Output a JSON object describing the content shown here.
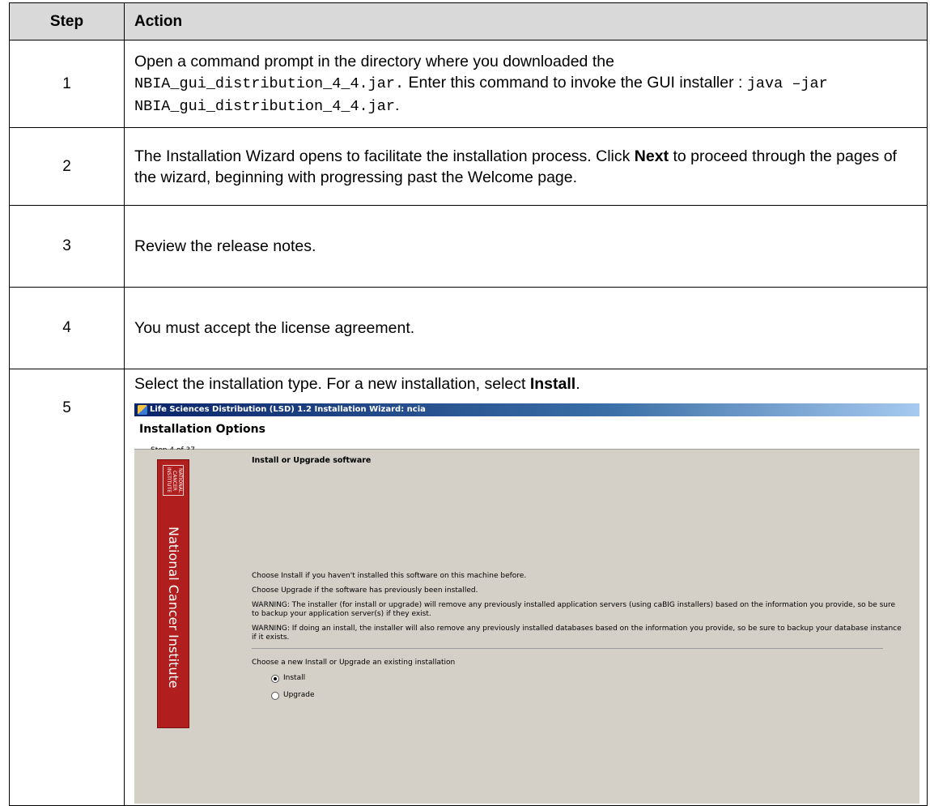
{
  "table": {
    "header": {
      "step": "Step",
      "action": "Action"
    },
    "rows": [
      {
        "step": "1",
        "action": {
          "t1": "Open a command prompt in the directory where you downloaded the",
          "code1": "NBIA_gui_distribution_4_4.jar.",
          "t2": " Enter this command to invoke the GUI installer : ",
          "code2": "java –jar NBIA_gui_distribution_4_4.jar",
          "t3": "."
        }
      },
      {
        "step": "2",
        "action": {
          "t1": "The Installation Wizard opens to facilitate the installation process. Click ",
          "bold": "Next",
          "t2": " to proceed through the pages of the wizard, beginning with progressing past the Welcome page."
        }
      },
      {
        "step": "3",
        "action": {
          "text": "Review the release notes."
        }
      },
      {
        "step": "4",
        "action": {
          "text": "You must accept the license agreement."
        }
      },
      {
        "step": "5",
        "action": {
          "t1": "Select the installation type. For a new installation, select ",
          "bold": "Install",
          "t2": "."
        }
      }
    ]
  },
  "wizard": {
    "window_title": "Life Sciences Distribution (LSD) 1.2 Installation Wizard: ncia",
    "header_title": "Installation Options",
    "step_text": "Step 4 of 37",
    "banner_text": "National Cancer Institute",
    "logo_text": "NATIONAL CANCER INSTITUTE",
    "section_title": "Install or Upgrade software",
    "lines": [
      "Choose Install if you haven't installed this software on this machine before.",
      "Choose Upgrade if the software has previously been installed.",
      "WARNING: The installer (for install or upgrade) will remove any previously installed application servers (using caBIG installers) based on the information you provide, so be sure to backup your application server(s) if they exist.",
      "WARNING: If doing an install, the installer will also remove any previously installed databases based on the information you provide, so be sure to backup your database instance if it exists."
    ],
    "choose_label": "Choose a new Install or Upgrade an existing installation",
    "options": [
      {
        "label": "Install",
        "selected": true
      },
      {
        "label": "Upgrade",
        "selected": false
      }
    ],
    "colors": {
      "banner": "#b01e1e",
      "dialog_bg": "#d4d0c8",
      "titlebar": "#0a246a"
    }
  }
}
